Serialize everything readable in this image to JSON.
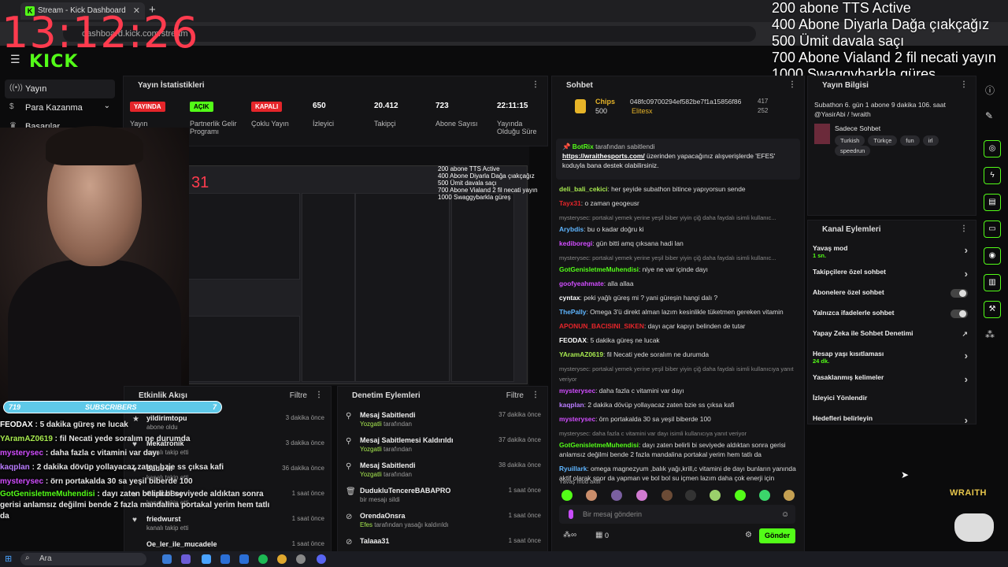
{
  "browser": {
    "tab_title": "Stream - Kick Dashboard",
    "url": "dashboard.kick.com/stream"
  },
  "stream_clock": "13:12:26",
  "goals_overlay": [
    "200 abone TTS Active",
    "400 Abone Diyarla Dağa çıakçağız",
    "500 Ümit davala saçı",
    "700 Abone Vialand 2 fil necati yayın",
    "1000 Swaggybarkla güreş"
  ],
  "brand": {
    "logo": "KICK",
    "accent": "#53fc18"
  },
  "sidebar": {
    "items": [
      {
        "label": "Yayın",
        "icon": "broadcast-icon"
      },
      {
        "label": "Para Kazanma",
        "icon": "dollar-icon"
      },
      {
        "label": "Başarılar",
        "icon": "trophy-icon"
      }
    ]
  },
  "stats": {
    "title": "Yayın İstatistikleri",
    "items": [
      {
        "badge": "YAYINDA",
        "label": "Yayın",
        "color": "#e5252a"
      },
      {
        "badge": "AÇIK",
        "label": "Partnerlik Gelir Programı",
        "color": "#53fc18"
      },
      {
        "badge": "KAPALI",
        "label": "Çoklu Yayın",
        "color": "#e5252a"
      },
      {
        "value": "650",
        "label": "İzleyici"
      },
      {
        "value": "20.412",
        "label": "Takipçi"
      },
      {
        "value": "723",
        "label": "Abone Sayısı"
      },
      {
        "value": "22:11:15",
        "label": "Yayında Olduğu Süre"
      }
    ]
  },
  "subscribers_bar": {
    "left": "719",
    "label": "SUBSCRIBERS",
    "right": "7"
  },
  "overlay_chat": [
    {
      "user": "FEODAX",
      "text": "5 dakika güreş ne lucak",
      "color": "#fff"
    },
    {
      "user": "YAramAZ0619",
      "text": "fil Necati yede soralım ne durumda",
      "color": "#a7e94f"
    },
    {
      "user": "mysterysec",
      "text": "daha fazla c vitamini var dayı",
      "color": "#d14dff"
    },
    {
      "user": "kaqplan",
      "text": "2 dakika dövüp yollayacaz zaten bzie ss çıksa kafi",
      "color": "#b97cff"
    },
    {
      "user": "mysterysec",
      "text": "örn portakalda 30 sa yeşil biberde 100",
      "color": "#d14dff"
    },
    {
      "user": "GotGenisletmeMuhendisi",
      "text": "dayı zaten belirli bi seviyede aldıktan sonra gerisi anlamsız değilmi bende 2 fazla mandalina portakal yerim hem tatlı da",
      "color": "#53fc18"
    }
  ],
  "activity": {
    "title": "Etkinlik Akışı",
    "filter": "Filtre",
    "items": [
      {
        "name": "yildirimtopu",
        "sub": "abone oldu",
        "time": "3 dakika önce"
      },
      {
        "name": "Mekatronik",
        "sub": "kanalı takip etti",
        "time": "3 dakika önce"
      },
      {
        "name": "Sudo-M",
        "sub": "kanalı takip etti",
        "time": "36 dakika önce"
      },
      {
        "name": "CapitalBoy",
        "sub": "kanalı takip etti",
        "time": "1 saat önce"
      },
      {
        "name": "friedwurst",
        "sub": "kanalı takip etti",
        "time": "1 saat önce"
      },
      {
        "name": "Oe_ler_ile_mucadele",
        "sub": "",
        "time": "1 saat önce"
      }
    ]
  },
  "moderation": {
    "title": "Denetim Eylemleri",
    "filter": "Filtre",
    "items": [
      {
        "name": "Mesaj Sabitlendi",
        "by": "Yozgatli",
        "sub": "tarafından",
        "time": "37 dakika önce",
        "icon": "pin-icon"
      },
      {
        "name": "Mesaj Sabitlemesi Kaldırıldı",
        "by": "Yozgatli",
        "sub": "tarafından",
        "time": "37 dakika önce",
        "icon": "unpin-icon"
      },
      {
        "name": "Mesaj Sabitlendi",
        "by": "Yozgatli",
        "sub": "tarafından",
        "time": "38 dakika önce",
        "icon": "pin-icon"
      },
      {
        "name": "DudukluTencereBABAPRO",
        "by": "",
        "sub": "bir mesajı sildi",
        "time": "1 saat önce",
        "icon": "trash-icon"
      },
      {
        "name": "OrendaOnsra",
        "by": "Efes",
        "sub": "tarafından yasağı kaldırıldı",
        "time": "1 saat önce",
        "icon": "unban-icon"
      },
      {
        "name": "Talaaa31",
        "by": "",
        "sub": "",
        "time": "1 saat önce",
        "icon": "ban-icon"
      }
    ]
  },
  "chat": {
    "title": "Sohbet",
    "chips_label": "Chips",
    "chips_value": "500",
    "top_user": "048fc09700294ef582be7f1a15856f86",
    "top_user_amount": "417",
    "elitesx": "Elitesx",
    "elitesx_amount": "252",
    "pinned_by": "BotRix",
    "pinned_suffix": "tarafından sabitlendi",
    "pinned_link": "https://wraithesports.com/",
    "pinned_text": "üzerinden yapacağınız alışverişlerde 'EFES' koduyla bana destek olabilirsiniz.",
    "messages": [
      {
        "user": "deli_bali_cekici",
        "text": "her şeyide subathon bitince yapıyorsun sende",
        "color": "#a7e94f"
      },
      {
        "user": "Tayx31",
        "text": "o zaman geogeusr",
        "color": "#e5252a"
      },
      {
        "reply": "mysterysec: portakal yemek yerine yeşil biber yiyin çiğ daha faydalı isimli kullanıc..."
      },
      {
        "user": "Arybdis",
        "text": "bu o kadar doğru ki",
        "color": "#5eb5ff"
      },
      {
        "user": "kediboregi",
        "text": "gün bitti amq çıksana hadi lan",
        "color": "#d14dff"
      },
      {
        "reply": "mysterysec: portakal yemek yerine yeşil biber yiyin çiğ daha faydalı isimli kullanıc..."
      },
      {
        "user": "GotGenisletmeMuhendisi",
        "text": "niye ne var içinde dayı",
        "color": "#53fc18"
      },
      {
        "user": "goofyeahmate",
        "text": "alla allaa",
        "color": "#d14dff"
      },
      {
        "user": "cyntax",
        "text": "peki yağlı güreş mi ? yani güreşin hangi dalı ?",
        "color": "#fff"
      },
      {
        "user": "ThePally",
        "text": "Omega 3'ü direkt alman lazım kesinlikle tüketmen gereken vitamin",
        "color": "#5eb5ff"
      },
      {
        "user": "APONUN_BACISINI_SIKEN",
        "text": "dayı açar kapıyı belinden de tutar",
        "color": "#e5252a"
      },
      {
        "user": "FEODAX",
        "text": "5 dakika güreş ne lucak",
        "color": "#fff"
      },
      {
        "user": "YAramAZ0619",
        "text": "fil Necati yede soralım ne durumda",
        "color": "#a7e94f"
      },
      {
        "reply": "mysterysec: portakal yemek yerine yeşil biber yiyin çiğ daha faydalı isimli kullanıcıya yanıt veriyor"
      },
      {
        "user": "mysterysec",
        "text": "daha fazla c vitamini var dayı",
        "color": "#d14dff"
      },
      {
        "user": "kaqplan",
        "text": "2 dakika dövüp yollayacaz zaten bzie ss çıksa kafi",
        "color": "#b97cff"
      },
      {
        "user": "mysterysec",
        "text": "örn portakalda 30 sa yeşil biberde 100",
        "color": "#d14dff"
      },
      {
        "reply": "mysterysec: daha fazla c vitamini var dayı isimli kullanıcıya yanıt veriyor"
      },
      {
        "user": "GotGenisletmeMuhendisi",
        "text": "dayı zaten belirli bi seviyede aldıktan sonra gerisi anlamsız değilmi bende 2 fazla mandalina portakal yerim hem tatlı da",
        "color": "#53fc18"
      },
      {
        "user": "Ryuillark",
        "text": "omega magnezyum ,balık yağı,krill,c vitamini de dayı bunların yanında aktif olarak spor da yapman ve bol bol su içmen lazım daha çok enerji için",
        "color": "#5eb5ff"
      }
    ],
    "slow_mode": "Yavaş mod aktif",
    "input_placeholder": "Bir mesaj gönderin",
    "send": "Gönder",
    "points": "0"
  },
  "stream_info": {
    "title": "Yayın Bilgisi",
    "desc": "Subathon 6. gün 1 abone 9 dakika 106. saat @YasirAbi / !wraith",
    "category": "Sadece Sohbet",
    "tags": [
      "Turkish",
      "Türkçe",
      "fun",
      "irl",
      "speedrun"
    ]
  },
  "channel_actions": {
    "title": "Kanal Eylemleri",
    "items": [
      {
        "label": "Yavaş mod",
        "sub": "1 sn.",
        "control": "chevron"
      },
      {
        "label": "Takipçilere özel sohbet",
        "sub": "",
        "control": "chevron"
      },
      {
        "label": "Abonelere özel sohbet",
        "sub": "",
        "control": "toggle"
      },
      {
        "label": "Yalnızca ifadelerle sohbet",
        "sub": "",
        "control": "toggle"
      },
      {
        "label": "Yapay Zeka ile Sohbet Denetimi",
        "sub": "",
        "control": "external"
      },
      {
        "label": "Hesap yaşı kısıtlaması",
        "sub": "24 dk.",
        "control": "chevron"
      },
      {
        "label": "Yasaklanmış kelimeler",
        "sub": "",
        "control": "chevron"
      },
      {
        "label": "İzleyici Yönlendir",
        "sub": "",
        "control": "none"
      },
      {
        "label": "Hedefleri belirleyin",
        "sub": "",
        "control": "chevron"
      }
    ]
  },
  "overlay_brand": "WRAITH",
  "taskbar": {
    "search": "Ara"
  }
}
